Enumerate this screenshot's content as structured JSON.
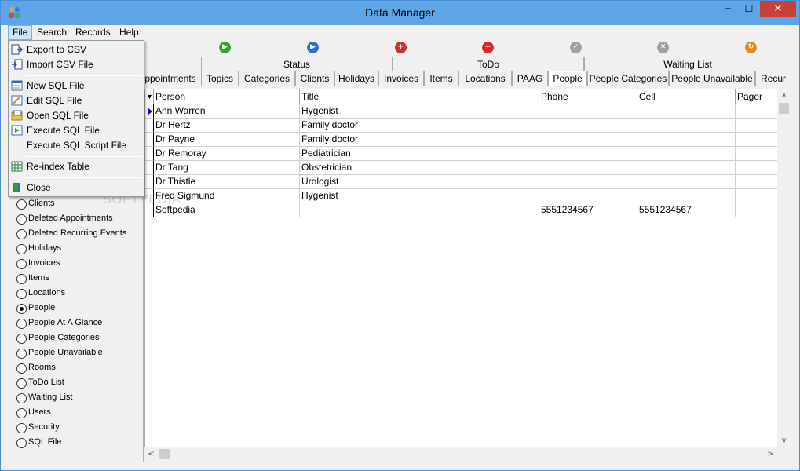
{
  "window": {
    "title": "Data Manager",
    "min_label": "─",
    "max_label": "☐",
    "close_label": "✕"
  },
  "menubar": {
    "file": "File",
    "search": "Search",
    "records": "Records",
    "help": "Help"
  },
  "toolbar": {
    "icons": [
      {
        "name": "first-record-icon",
        "color": "#2fa52f",
        "glyph": "▶"
      },
      {
        "name": "next-record-icon",
        "color": "#2a6fd6",
        "glyph": "▶"
      },
      {
        "name": "add-record-icon",
        "color": "#d62a2a",
        "glyph": "+"
      },
      {
        "name": "delete-record-icon",
        "color": "#d62a2a",
        "glyph": "−"
      },
      {
        "name": "check-icon",
        "color": "#a0a0a0",
        "glyph": "✓"
      },
      {
        "name": "cancel-icon",
        "color": "#a0a0a0",
        "glyph": "✕"
      },
      {
        "name": "refresh-icon",
        "color": "#e88a1a",
        "glyph": "↻"
      }
    ]
  },
  "tabs_row1": [
    "Status",
    "ToDo",
    "Waiting List"
  ],
  "tabs_row2": [
    "ppointments",
    "Topics",
    "Categories",
    "Clients",
    "Holidays",
    "Invoices",
    "Items",
    "Locations",
    "PAAG",
    "People",
    "People Categories",
    "People Unavailable",
    "Recur"
  ],
  "grid": {
    "columns": [
      "Person",
      "Title",
      "Phone",
      "Cell",
      "Pager"
    ],
    "rows": [
      [
        "Ann Warren",
        "Hygenist",
        "",
        "",
        ""
      ],
      [
        "Dr Hertz",
        "Family doctor",
        "",
        "",
        ""
      ],
      [
        "Dr Payne",
        "Family doctor",
        "",
        "",
        ""
      ],
      [
        "Dr Remoray",
        "Pediatrician",
        "",
        "",
        ""
      ],
      [
        "Dr Tang",
        "Obstetrician",
        "",
        "",
        ""
      ],
      [
        "Dr Thistle",
        "Urologist",
        "",
        "",
        ""
      ],
      [
        "Fred Sigmund",
        "Hygenist",
        "",
        "",
        ""
      ],
      [
        "Softpedia",
        "",
        "5551234567",
        "5551234567",
        ""
      ]
    ]
  },
  "scroll": {
    "up": "∧",
    "down": "∨",
    "left": "<",
    "right": ">"
  },
  "radios": [
    {
      "label": "Clients",
      "checked": false
    },
    {
      "label": "Deleted Appointments",
      "checked": false
    },
    {
      "label": "Deleted Recurring Events",
      "checked": false
    },
    {
      "label": "Holidays",
      "checked": false
    },
    {
      "label": "Invoices",
      "checked": false
    },
    {
      "label": "Items",
      "checked": false
    },
    {
      "label": "Locations",
      "checked": false
    },
    {
      "label": "People",
      "checked": true
    },
    {
      "label": "People At A Glance",
      "checked": false
    },
    {
      "label": "People Categories",
      "checked": false
    },
    {
      "label": "People Unavailable",
      "checked": false
    },
    {
      "label": "Rooms",
      "checked": false
    },
    {
      "label": "ToDo List",
      "checked": false
    },
    {
      "label": "Waiting List",
      "checked": false
    },
    {
      "label": "Users",
      "checked": false
    },
    {
      "label": "Security",
      "checked": false
    },
    {
      "label": "SQL File",
      "checked": false
    }
  ],
  "file_menu": {
    "export_csv": "Export to CSV",
    "import_csv": "Import CSV File",
    "new_sql": "New SQL File",
    "edit_sql": "Edit SQL File",
    "open_sql": "Open SQL File",
    "execute_sql": "Execute SQL File",
    "execute_sql_script": "Execute SQL Script File",
    "reindex": "Re-index Table",
    "close": "Close"
  },
  "watermark": "SOFTPEDIA"
}
